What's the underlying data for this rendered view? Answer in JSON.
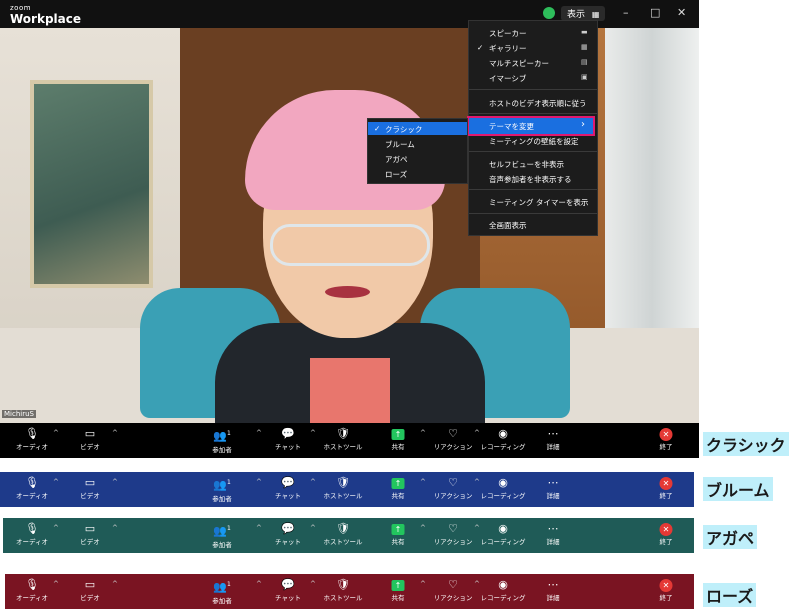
{
  "app": {
    "logo_small": "zoom",
    "logo_big": "Workplace"
  },
  "titlebar": {
    "view_label": "表示",
    "grid_icon": "▦",
    "minimize": "–",
    "maximize": "□",
    "close": "✕"
  },
  "participant": {
    "name": "MichiruS"
  },
  "view_menu": {
    "items": [
      {
        "label": "スピーカー",
        "checked": false,
        "icon": "▬"
      },
      {
        "label": "ギャラリー",
        "checked": true,
        "icon": "▦"
      },
      {
        "label": "マルチスピーカー",
        "checked": false,
        "icon": "▤"
      },
      {
        "label": "イマーシブ",
        "checked": false,
        "icon": "▣"
      },
      {
        "label": "ホストのビデオ表示順に従う"
      },
      {
        "label": "テーマを変更"
      },
      {
        "label": "ミーティングの壁紙を設定"
      },
      {
        "label": "セルフビューを非表示"
      },
      {
        "label": "音声参加者を非表示する"
      },
      {
        "label": "ミーティング タイマーを表示"
      },
      {
        "label": "全画面表示"
      }
    ],
    "check_mark": "✓",
    "submenu_arrow": "›"
  },
  "theme_submenu": {
    "items": [
      {
        "label": "クラシック",
        "checked": true
      },
      {
        "label": "ブルーム"
      },
      {
        "label": "アガペ"
      },
      {
        "label": "ローズ"
      }
    ]
  },
  "toolbar": {
    "audio": "オーディオ",
    "video": "ビデオ",
    "participants": "参加者",
    "participants_count": "1",
    "chat": "チャット",
    "host_tools": "ホストツール",
    "share": "共有",
    "reactions": "リアクション",
    "recording": "レコーディング",
    "more": "詳細",
    "end": "終了",
    "caret": "^"
  },
  "themes": [
    {
      "name": "クラシック",
      "color": "#000000"
    },
    {
      "name": "ブルーム",
      "color": "#1e3a8a"
    },
    {
      "name": "アガペ",
      "color": "#1f5b57"
    },
    {
      "name": "ローズ",
      "color": "#7a1422"
    }
  ]
}
